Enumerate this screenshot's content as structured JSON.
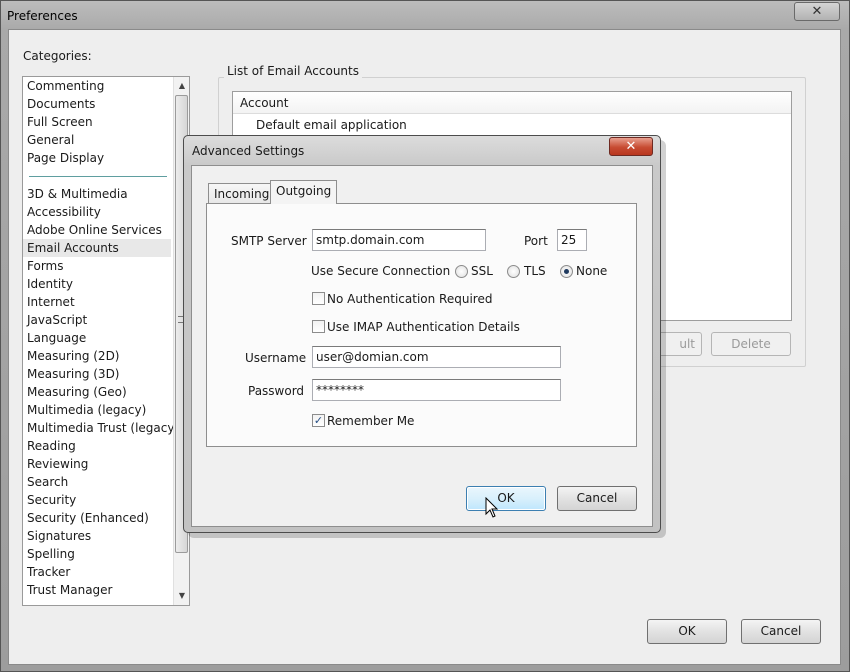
{
  "preferences": {
    "title": "Preferences",
    "close_glyph": "✕",
    "categories_label": "Categories:",
    "categories": [
      "Commenting",
      "Documents",
      "Full Screen",
      "General",
      "Page Display",
      "3D & Multimedia",
      "Accessibility",
      "Adobe Online Services",
      "Email Accounts",
      "Forms",
      "Identity",
      "Internet",
      "JavaScript",
      "Language",
      "Measuring (2D)",
      "Measuring (3D)",
      "Measuring (Geo)",
      "Multimedia (legacy)",
      "Multimedia Trust (legacy)",
      "Reading",
      "Reviewing",
      "Search",
      "Security",
      "Security (Enhanced)",
      "Signatures",
      "Spelling",
      "Tracker",
      "Trust Manager"
    ],
    "selected_category": "Email Accounts",
    "list_group_title": "List of Email Accounts",
    "accounts_header": "Account",
    "accounts": [
      "Default email application"
    ],
    "partial_default_button": "ult",
    "delete_button": "Delete",
    "ok_button": "OK",
    "cancel_button": "Cancel"
  },
  "advanced": {
    "title": "Advanced Settings",
    "close_glyph": "✕",
    "tabs": [
      "Incoming",
      "Outgoing"
    ],
    "active_tab": "Outgoing",
    "smtp_label": "SMTP Server",
    "smtp_value": "smtp.domain.com",
    "port_label": "Port",
    "port_value": "25",
    "secure_label": "Use Secure Connection",
    "secure_options": [
      "SSL",
      "TLS",
      "None"
    ],
    "secure_selected": "None",
    "no_auth_label": "No Authentication Required",
    "no_auth_checked": false,
    "imap_auth_label": "Use IMAP Authentication Details",
    "imap_auth_checked": false,
    "username_label": "Username",
    "username_value": "user@domian.com",
    "password_label": "Password",
    "password_value": "********",
    "remember_label": "Remember Me",
    "remember_checked": true,
    "check_glyph": "✓",
    "ok_button": "OK",
    "cancel_button": "Cancel"
  },
  "colors": {
    "close_red": "#c74b32",
    "focus_blue": "#3c7fb1",
    "separator_teal": "#5f9ea0"
  }
}
